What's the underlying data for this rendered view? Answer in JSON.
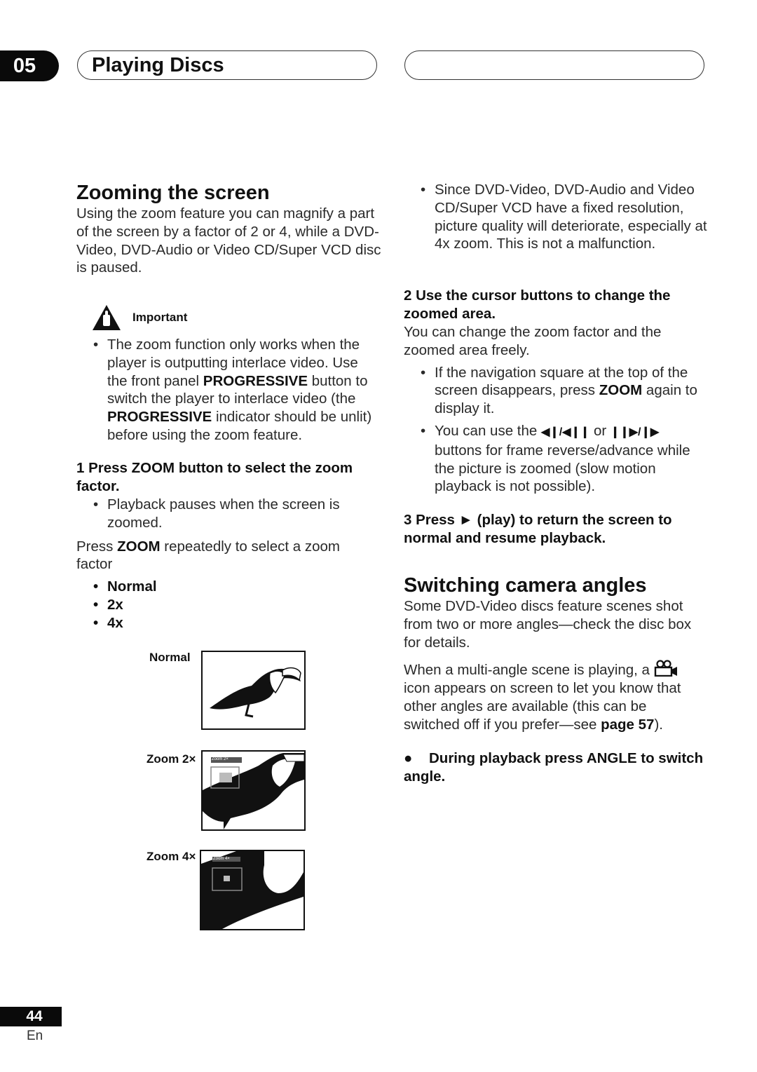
{
  "header": {
    "chapter_number": "05",
    "chapter_title": "Playing Discs"
  },
  "left": {
    "heading": "Zooming the screen",
    "intro": "Using the zoom feature you can magnify a part of the screen by a factor of 2 or 4, while a DVD-Video, DVD-Audio or Video CD/Super VCD disc is paused.",
    "important_label": "Important",
    "important_bullet": {
      "t1": "The zoom function only works when the player is outputting interlace video. Use the front panel ",
      "b1": "PROGRESSIVE",
      "t2": " button to switch the player to interlace video (the ",
      "b2": "PROGRESSIVE",
      "t3": " indicator should be unlit) before using the zoom feature."
    },
    "step1": "1    Press ZOOM button to  select the zoom factor.",
    "step1_bullet": "Playback pauses when the screen is zoomed.",
    "press_zoom": {
      "t1": "Press ",
      "b1": "ZOOM",
      "t2": " repeatedly to select a zoom factor"
    },
    "zoom_options": [
      "Normal",
      "2x",
      "4x"
    ],
    "figures": [
      {
        "label": "Normal",
        "overlay": ""
      },
      {
        "label": "Zoom 2×",
        "overlay": "Zoom 2×"
      },
      {
        "label": "Zoom 4×",
        "overlay": "Zoom 4×"
      }
    ]
  },
  "right": {
    "bullet_resolution": "Since DVD-Video, DVD-Audio and Video CD/Super VCD have a fixed resolution, picture quality will deteriorate, especially at 4x zoom. This is not a malfunction.",
    "step2": "2    Use the cursor buttons to change the zoomed area.",
    "step2_body": "You can change the zoom factor and the zoomed area freely.",
    "bullet_nav": {
      "t1": "If the navigation square at the top of the screen disappears, press ",
      "b1": "ZOOM",
      "t2": " again to display it."
    },
    "bullet_frame": {
      "t1": "You can use the ",
      "b1": "◀❙/◀❙❙",
      "t2": " or ",
      "b2": "❙❙▶/❙▶",
      "t3": " buttons for frame reverse/advance while the picture is zoomed (slow motion playback is not possible)."
    },
    "step3": "3    Press ► (play) to return the screen to normal and resume playback.",
    "heading2": "Switching camera angles",
    "angles_intro": "Some DVD-Video discs feature scenes shot from two or more angles—check the disc box for details.",
    "multi_angle": {
      "t1": "When a multi-angle scene is playing, a ",
      "t2": " icon appears on screen to let you know that other angles are available (this can be switched off if you prefer—see ",
      "link": "page 57",
      "t3": ")."
    },
    "step_angle": "During playback press ANGLE to switch angle."
  },
  "footer": {
    "page_number": "44",
    "language": "En"
  }
}
